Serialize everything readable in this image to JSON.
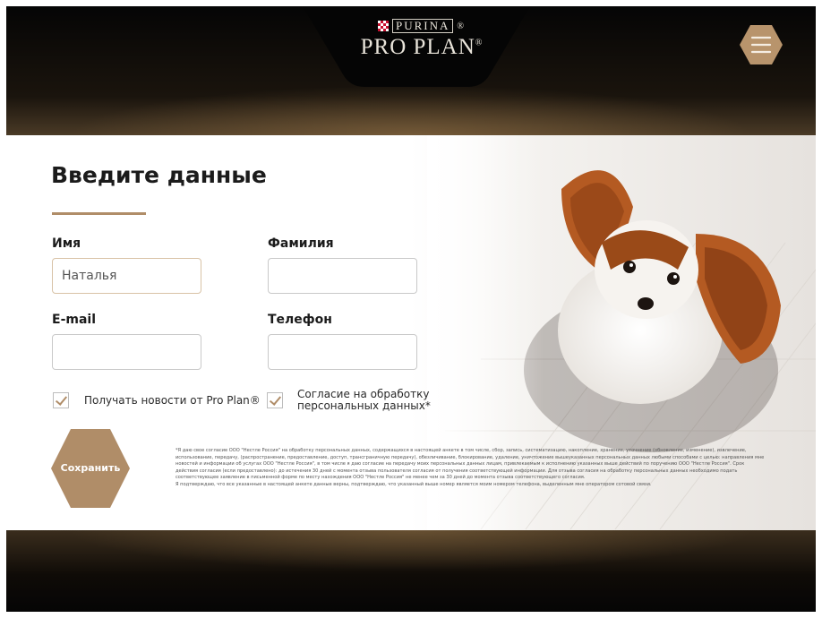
{
  "brand": {
    "purina": "PURINA",
    "proplan": "PRO PLAN",
    "reg_mark": "®"
  },
  "header": {
    "menu_icon": "hamburger-icon"
  },
  "form": {
    "title": "Введите данные",
    "first_name": {
      "label": "Имя",
      "value": "Наталья",
      "placeholder": ""
    },
    "last_name": {
      "label": "Фамилия",
      "value": "",
      "placeholder": ""
    },
    "email": {
      "label": "E-mail",
      "value": "",
      "placeholder": ""
    },
    "phone": {
      "label": "Телефон",
      "value": "",
      "placeholder": ""
    },
    "checkbox_news": {
      "label": "Получать новости от Pro Plan®",
      "checked": true
    },
    "checkbox_consent": {
      "label_line1": "Согласие на обработку",
      "label_line2": "персональных данных",
      "asterisk": "*",
      "checked": true
    },
    "save_label": "Сохранить",
    "legal_1": "*Я даю свое согласие ООО \"Нестле Россия\" на обработку персональных данных, содержащихся в настоящей анкете в том числе, сбор, запись, систематизацию, накопление, хранение, уточнение (обновление, изменение), извлечение, использование, передачу, (распространение, предоставление, доступ, трансграничную передачу), обезличивание, блокирование, удаление, уничтожение вышеуказанных персональных данных любыми способами с целью: направления мне новостей и информации об услугах ООО \"Нестле Россия\", в том числе я даю согласие на передачу моих персональных данных лицам, привлекаемым к исполнению указанных выше действий по поручению ООО \"Нестле Россия\". Срок действия согласия (если предоставлено): до истечения 30 дней с момента отзыва пользователя согласия от получения соответствующей информации. Для отзыва согласия на обработку персональных данных необходимо подать соответствующее заявление в письменной форме по месту нахождения ООО \"Нестле Россия\" не менее чем за 30 дней до момента отзыва соответствующего согласия.",
    "legal_2": "Я подтверждаю, что все указанные в настоящей анкете данные верны, подтверждаю, что указанный выше номер является моим номером телефона, выделенным мне оператором сотовой связи."
  },
  "colors": {
    "accent": "#b08d68",
    "dark": "#0a0a0a"
  }
}
